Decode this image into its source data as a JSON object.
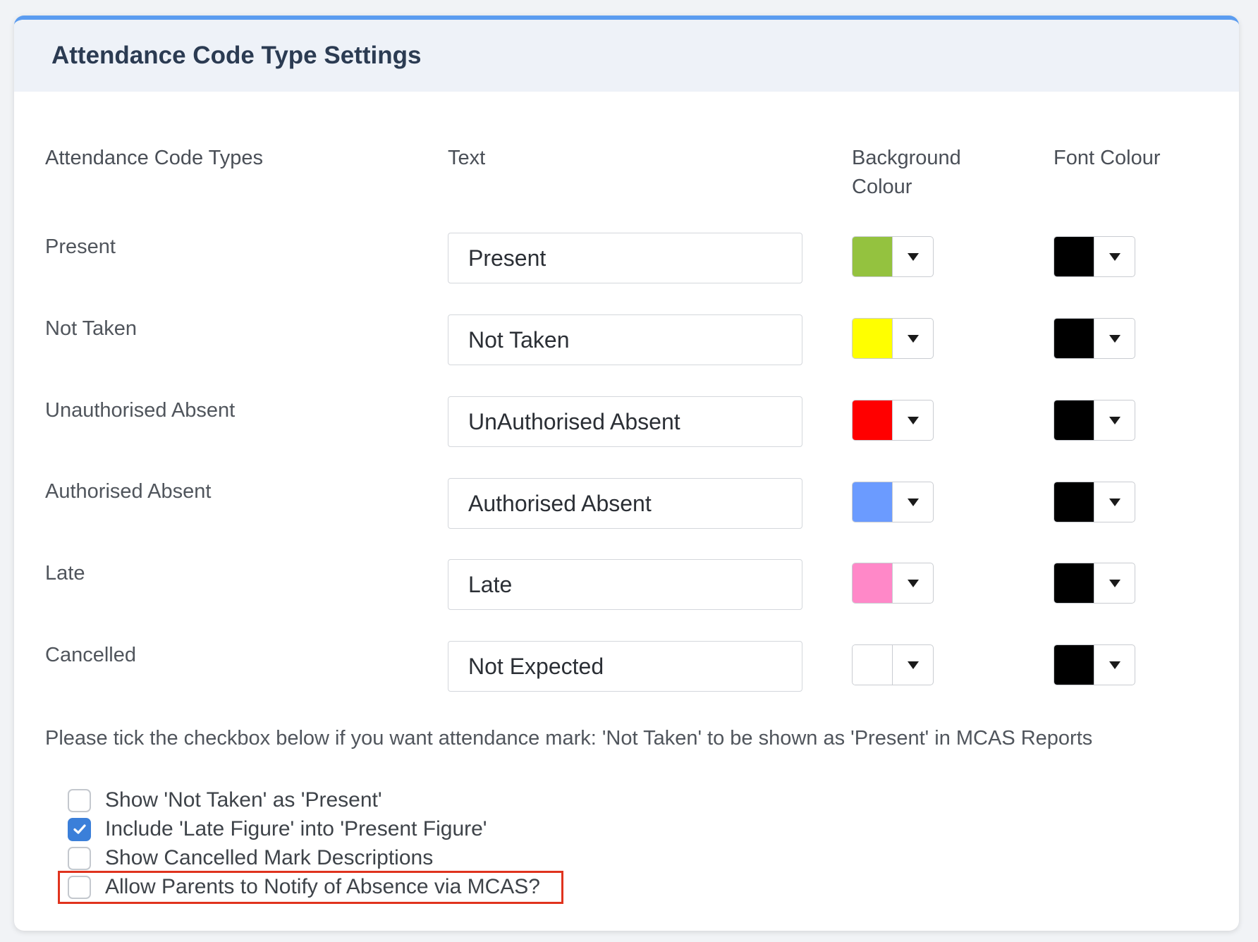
{
  "header": {
    "title": "Attendance Code Type Settings"
  },
  "columns": {
    "types": "Attendance Code Types",
    "text": "Text",
    "background_line1": "Background",
    "background_line2": "Colour",
    "font": "Font Colour"
  },
  "rows": [
    {
      "label": "Present",
      "text": "Present",
      "background": "#94c23f",
      "font_color": "#000000"
    },
    {
      "label": "Not Taken",
      "text": "Not Taken",
      "background": "#ffff00",
      "font_color": "#000000"
    },
    {
      "label": "Unauthorised Absent",
      "text": "UnAuthorised Absent",
      "background": "#ff0000",
      "font_color": "#000000"
    },
    {
      "label": "Authorised Absent",
      "text": "Authorised Absent",
      "background": "#6b9bff",
      "font_color": "#000000"
    },
    {
      "label": "Late",
      "text": "Late",
      "background": "#ff88c8",
      "font_color": "#000000"
    },
    {
      "label": "Cancelled",
      "text": "Not Expected",
      "background": "#ffffff",
      "font_color": "#000000"
    }
  ],
  "note": "Please tick the checkbox below if you want attendance mark: 'Not Taken' to be shown as 'Present' in MCAS Reports",
  "options": [
    {
      "label": "Show 'Not Taken' as 'Present'",
      "checked": false
    },
    {
      "label": "Include 'Late Figure' into 'Present Figure'",
      "checked": true
    },
    {
      "label": "Show Cancelled Mark Descriptions",
      "checked": false
    },
    {
      "label": "Allow Parents to Notify of Absence via MCAS?",
      "checked": false,
      "highlighted": true
    }
  ],
  "colors": {
    "accent": "#5b9cf0",
    "checkbox_checked": "#3b7fd9",
    "highlight_border": "#e0331e"
  }
}
